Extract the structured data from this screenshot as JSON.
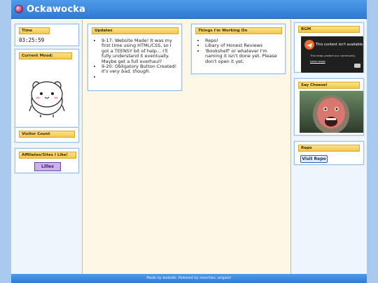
{
  "header": {
    "title": "Ockawocka"
  },
  "left": {
    "time": {
      "title": "Time",
      "value": "03:25:59"
    },
    "mood": {
      "title": "Current Mood:"
    },
    "visitor": {
      "title": "Visitor Count"
    },
    "affiliates": {
      "title": "Affiliates/Sites I Like!",
      "badge_text": "Lillex"
    }
  },
  "main": {
    "updates": {
      "title": "Updates",
      "items": [
        {
          "text": "9-17: Website Made! It was my first time using HTML/CSS, so I got a TEENSY bit of help... I'll fully understand it eventually. Maybe get a full overhaul?"
        },
        {
          "text": "9-20: Obligatory Button Created! ",
          "emphasis": "It's very bad, though."
        },
        {
          "text": ""
        }
      ]
    },
    "working": {
      "title": "Things I'm Working On",
      "items": [
        "Repo!",
        "Libary of Honest Reviews",
        "'Bookshelf' or whatever I'm naming it isn't done yet. Please don't open it yet."
      ]
    }
  },
  "right": {
    "bgm": {
      "title": "BGM",
      "headline": "This content isn't available.",
      "sub": "This helps protect our community.",
      "link": "Learn more"
    },
    "cheese": {
      "title": "Say Cheese!"
    },
    "repo": {
      "title": "Repo",
      "button": "Visit Repo"
    }
  },
  "footer": {
    "text": "Made by wabods. Powered by neocities. arigato!"
  },
  "colors": {
    "header": "#2f7bd6",
    "title_tab": "#f4c84a",
    "main_bg": "#fdf8e6",
    "side_bg": "#eef5fd"
  }
}
